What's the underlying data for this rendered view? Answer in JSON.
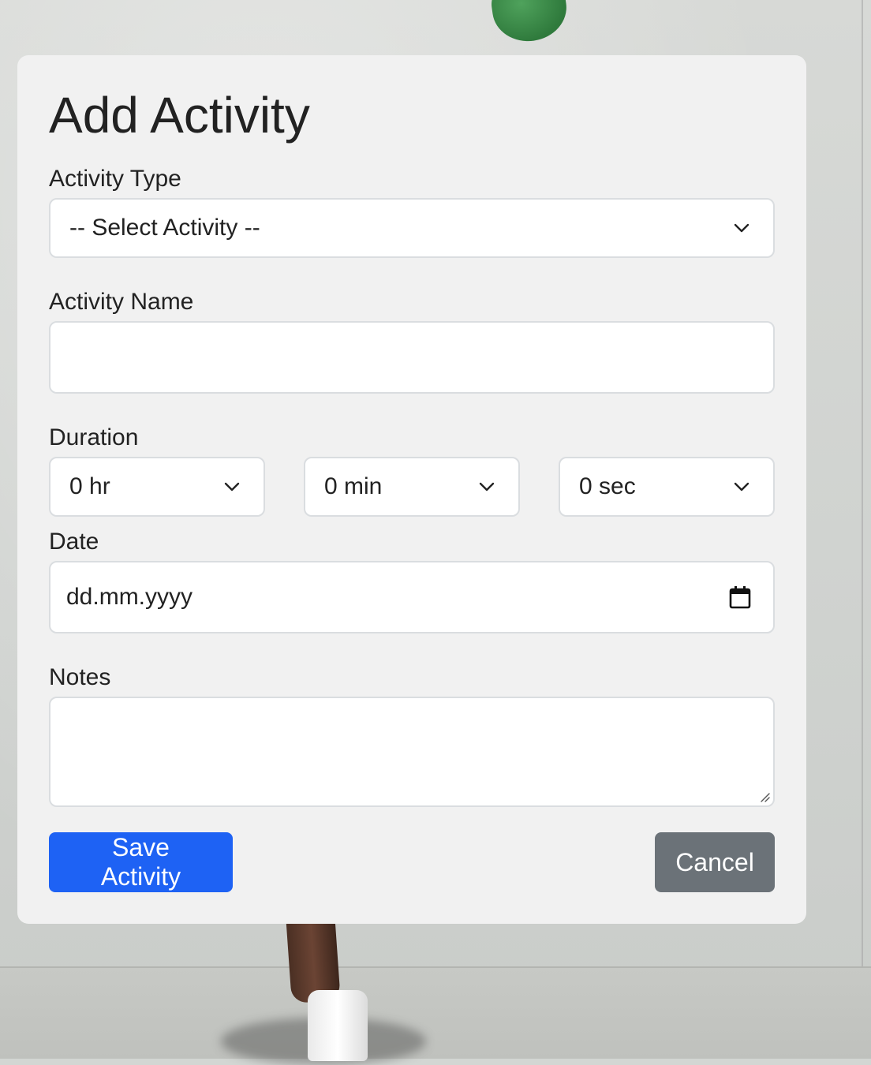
{
  "form": {
    "title": "Add Activity",
    "activity_type": {
      "label": "Activity Type",
      "selected": "-- Select Activity --"
    },
    "activity_name": {
      "label": "Activity Name",
      "value": ""
    },
    "duration": {
      "label": "Duration",
      "hours": "0 hr",
      "minutes": "0 min",
      "seconds": "0 sec"
    },
    "date": {
      "label": "Date",
      "placeholder": "dd.mm.yyyy"
    },
    "notes": {
      "label": "Notes",
      "value": ""
    },
    "buttons": {
      "save": "Save Activity",
      "cancel": "Cancel"
    }
  },
  "colors": {
    "primary": "#1e62f4",
    "secondary": "#6b7278",
    "card_bg": "#f1f1f1",
    "text": "#222222"
  },
  "icons": {
    "dropdown": "chevron-down-icon",
    "date_picker": "calendar-icon",
    "textarea_resize": "resize-handle-icon"
  }
}
